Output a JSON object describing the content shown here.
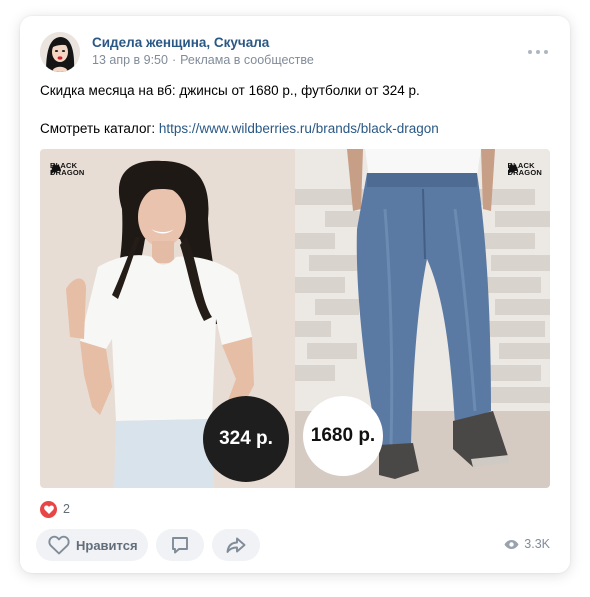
{
  "post": {
    "author": "Сидела женщина, Скучала",
    "date": "13 апр в 9:50",
    "ad_label": "Реклама в сообществе",
    "text_line1": "Скидка месяца на вб: джинсы от 1680 р., футболки от 324 р.",
    "text_catalog_label": "Смотреть каталог: ",
    "text_catalog_link": "https://www.wildberries.ru/brands/black-dragon"
  },
  "media": {
    "brand_line1": "Black",
    "brand_line2": "Dragon",
    "left_price": "324 р.",
    "right_price": "1680 р."
  },
  "footer": {
    "likes_count": "2",
    "like_label": "Нравится",
    "views_count": "3.3K"
  },
  "icons": {
    "more": "more-dots-icon",
    "reaction": "heart-icon",
    "like": "heart-outline-icon",
    "comment": "comment-icon",
    "share": "share-icon",
    "views": "eye-icon",
    "brand": "dragon-logo-icon"
  },
  "colors": {
    "link": "#2a5885",
    "meta": "#818c99",
    "reaction": "#e64646",
    "button_bg": "#f0f2f5"
  }
}
